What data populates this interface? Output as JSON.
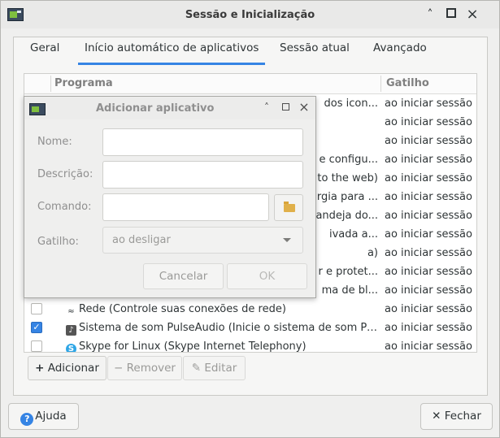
{
  "window": {
    "title": "Sessão e Inicialização",
    "controls": [
      "chevron-up-icon",
      "maximize-icon",
      "close-icon"
    ]
  },
  "tabs": [
    {
      "label": "Geral",
      "active": false
    },
    {
      "label": "Início automático de aplicativos",
      "active": true
    },
    {
      "label": "Sessão atual",
      "active": false
    },
    {
      "label": "Avançado",
      "active": false
    }
  ],
  "table": {
    "columns": {
      "program": "Programa",
      "trigger": "Gatilho"
    },
    "rows": [
      {
        "checked": false,
        "program": "dos icon...",
        "trigger": "ao iniciar sessão"
      },
      {
        "checked": false,
        "program": "",
        "trigger": "ao iniciar sessão"
      },
      {
        "checked": false,
        "program": "",
        "trigger": "ao iniciar sessão"
      },
      {
        "checked": false,
        "program": "e configu...",
        "trigger": "ao iniciar sessão"
      },
      {
        "checked": false,
        "program": "to the web)",
        "trigger": "ao iniciar sessão"
      },
      {
        "checked": false,
        "program": "rgia para ...",
        "trigger": "ao iniciar sessão"
      },
      {
        "checked": false,
        "program": "andeja do...",
        "trigger": "ao iniciar sessão"
      },
      {
        "checked": false,
        "program": "ivada a...",
        "trigger": "ao iniciar sessão"
      },
      {
        "checked": false,
        "program": "a)",
        "trigger": "ao iniciar sessão"
      },
      {
        "checked": false,
        "program": "r e protet...",
        "trigger": "ao iniciar sessão"
      },
      {
        "checked": false,
        "program": "ma de bl...",
        "trigger": "ao iniciar sessão"
      },
      {
        "checked": false,
        "icon": "wifi-icon",
        "program": "Rede (Controle suas conexões de rede)",
        "trigger": "ao iniciar sessão"
      },
      {
        "checked": true,
        "icon": "sound-icon",
        "program": "Sistema de som PulseAudio (Inicie o sistema de som Pul...",
        "trigger": "ao iniciar sessão"
      },
      {
        "checked": false,
        "icon": "skype-icon",
        "program": "Skype for Linux (Skype Internet Telephony)",
        "trigger": "ao iniciar sessão"
      }
    ]
  },
  "actions": {
    "add": "Adicionar",
    "remove": "Remover",
    "edit": "Editar"
  },
  "footer": {
    "help": "Ajuda",
    "close": "Fechar"
  },
  "dialog": {
    "title": "Adicionar aplicativo",
    "name_label": "Nome:",
    "name_value": "",
    "description_label": "Descrição:",
    "description_value": "",
    "command_label": "Comando:",
    "command_value": "",
    "trigger_label": "Gatilho:",
    "trigger_value": "ao desligar",
    "cancel": "Cancelar",
    "ok": "OK"
  },
  "colors": {
    "accent": "#3584e4",
    "window_bg": "#efefee"
  }
}
